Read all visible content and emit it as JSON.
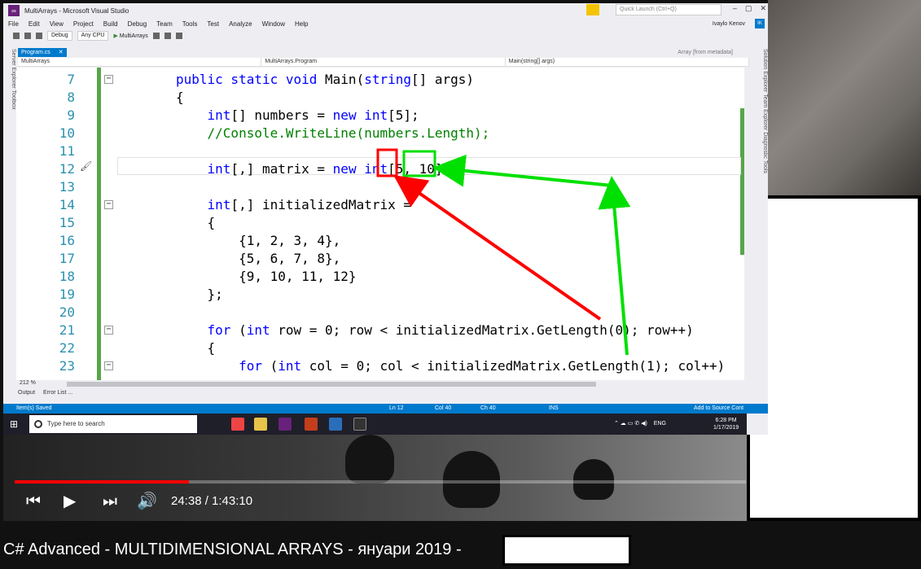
{
  "vs": {
    "window_title": "MultiArrays - Microsoft Visual Studio",
    "quick_launch_placeholder": "Quick Launch (Ctrl+Q)",
    "menu": [
      "File",
      "Edit",
      "View",
      "Project",
      "Build",
      "Debug",
      "Team",
      "Tools",
      "Test",
      "Analyze",
      "Window",
      "Help"
    ],
    "user": "Ivaylo Kenov",
    "user_initials": "IK",
    "toolbar": {
      "config": "Debug",
      "platform": "Any CPU",
      "start": "MultiArrays"
    },
    "tab_name": "Program.cs",
    "tab_meta": "Array [from metadata]",
    "nav": [
      "MultiArrays",
      "MultiArrays.Program",
      "Main(string[] args)"
    ],
    "left_panels": "Server Explorer   Toolbox",
    "right_panels": "Solution Explorer   Team Explorer   Diagnostic Tools",
    "zoom": "212 %",
    "bottom_tabs": [
      "Output",
      "Error List ..."
    ],
    "status": {
      "saved": "Item(s) Saved",
      "ln": "Ln 12",
      "col": "Col 40",
      "ch": "Ch 40",
      "ins": "INS",
      "source": "Add to Source Cont"
    }
  },
  "code_lines": [
    {
      "n": "7",
      "parts": [
        [
          "kw",
          "public static void "
        ],
        [
          "tx",
          "Main("
        ],
        [
          "kw",
          "string"
        ],
        [
          "tx",
          "[] args)"
        ]
      ]
    },
    {
      "n": "8",
      "parts": [
        [
          "tx",
          "{"
        ]
      ]
    },
    {
      "n": "9",
      "parts": [
        [
          "tx",
          "    "
        ],
        [
          "kw",
          "int"
        ],
        [
          "tx",
          "[] numbers = "
        ],
        [
          "kw",
          "new int"
        ],
        [
          "tx",
          "[5];"
        ]
      ]
    },
    {
      "n": "10",
      "parts": [
        [
          "tx",
          "    "
        ],
        [
          "cm",
          "//Console.WriteLine(numbers.Length);"
        ]
      ]
    },
    {
      "n": "11",
      "parts": []
    },
    {
      "n": "12",
      "parts": [
        [
          "tx",
          "    "
        ],
        [
          "kw",
          "int"
        ],
        [
          "tx",
          "[,] matrix = "
        ],
        [
          "kw",
          "new int"
        ],
        [
          "tx",
          "[5, 10];"
        ]
      ]
    },
    {
      "n": "13",
      "parts": []
    },
    {
      "n": "14",
      "parts": [
        [
          "tx",
          "    "
        ],
        [
          "kw",
          "int"
        ],
        [
          "tx",
          "[,] initializedMatrix ="
        ]
      ]
    },
    {
      "n": "15",
      "parts": [
        [
          "tx",
          "    {"
        ]
      ]
    },
    {
      "n": "16",
      "parts": [
        [
          "tx",
          "        {1, 2, 3, 4},"
        ]
      ]
    },
    {
      "n": "17",
      "parts": [
        [
          "tx",
          "        {5, 6, 7, 8},"
        ]
      ]
    },
    {
      "n": "18",
      "parts": [
        [
          "tx",
          "        {9, 10, 11, 12}"
        ]
      ]
    },
    {
      "n": "19",
      "parts": [
        [
          "tx",
          "    };"
        ]
      ]
    },
    {
      "n": "20",
      "parts": []
    },
    {
      "n": "21",
      "parts": [
        [
          "tx",
          "    "
        ],
        [
          "kw",
          "for"
        ],
        [
          "tx",
          " ("
        ],
        [
          "kw",
          "int"
        ],
        [
          "tx",
          " row = 0; row < initializedMatrix.GetLength(0); row++)"
        ]
      ]
    },
    {
      "n": "22",
      "parts": [
        [
          "tx",
          "    {"
        ]
      ]
    },
    {
      "n": "23",
      "parts": [
        [
          "tx",
          "        "
        ],
        [
          "kw",
          "for"
        ],
        [
          "tx",
          " ("
        ],
        [
          "kw",
          "int"
        ],
        [
          "tx",
          " col = 0; col < initializedMatrix.GetLength(1); col++)"
        ]
      ]
    }
  ],
  "taskbar": {
    "search_placeholder": "Type here to search",
    "lang": "ENG",
    "time": "6:28 PM",
    "date": "1/17/2019"
  },
  "player": {
    "current_time": "24:38",
    "duration": "1:43:10",
    "time_display": "24:38 / 1:43:10",
    "progress": 0.2387
  },
  "video_title": "C# Advanced - MULTIDIMENSIONAL ARRAYS - януари 2019 -",
  "colors": {
    "arrow_red": "#ff0000",
    "arrow_green": "#00e000",
    "accent": "#007acc"
  }
}
